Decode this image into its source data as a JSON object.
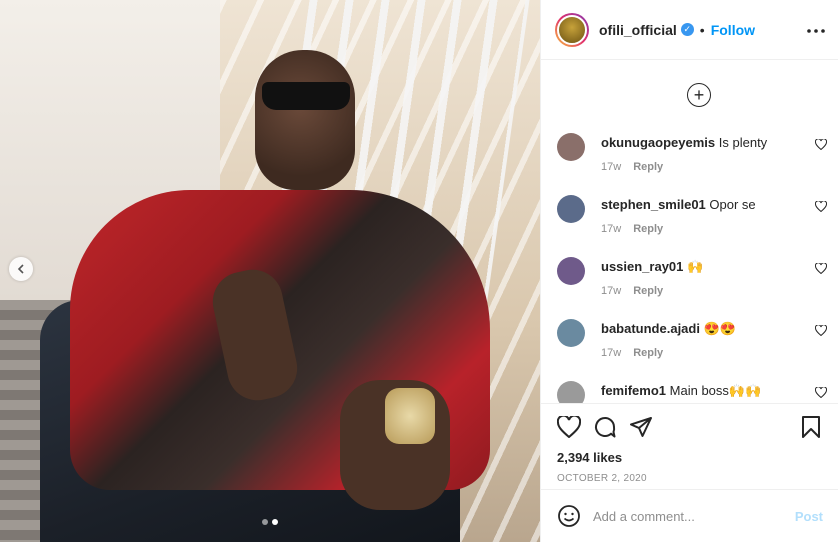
{
  "post": {
    "carousel_dots": 2,
    "carousel_active_index": 1
  },
  "header": {
    "username": "ofili_official",
    "verified_icon": "verified-badge-icon",
    "separator": "•",
    "follow_label": "Follow",
    "more_label": "···"
  },
  "comments_section": {
    "load_more_label": "+",
    "comments": [
      {
        "username": "okunugaopeyemis",
        "text": "Is plenty",
        "age": "17w",
        "reply_label": "Reply",
        "avatar_color": "#8a6f6a"
      },
      {
        "username": "stephen_smile01",
        "text": "Opor se",
        "age": "17w",
        "reply_label": "Reply",
        "avatar_color": "#5b6b8a"
      },
      {
        "username": "ussien_ray01",
        "text": "🙌",
        "age": "17w",
        "reply_label": "Reply",
        "avatar_color": "#6f5a8a"
      },
      {
        "username": "babatunde.ajadi",
        "text": "😍😍",
        "age": "17w",
        "reply_label": "Reply",
        "avatar_color": "#6a8aa0"
      },
      {
        "username": "femifemo1",
        "text": "Main boss🙌🙌",
        "age": "",
        "reply_label": "",
        "avatar_color": "#9a9a9a"
      }
    ]
  },
  "actions": {
    "likes": "2,394 likes",
    "date": "OCTOBER 2, 2020"
  },
  "add_comment": {
    "placeholder": "Add a comment...",
    "post_label": "Post"
  },
  "colors": {
    "accent": "#0095f6",
    "post_disabled": "#b2dffc",
    "meta_text": "#8e8e8e"
  }
}
